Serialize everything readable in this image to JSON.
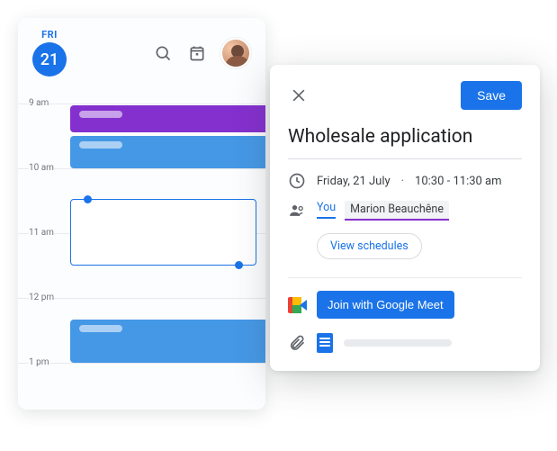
{
  "calendar": {
    "day_abbr": "FRI",
    "day_number": "21",
    "hours": [
      "9 am",
      "10 am",
      "11 am",
      "12 pm",
      "1 pm"
    ]
  },
  "panel": {
    "save_label": "Save",
    "title": "Wholesale application",
    "date_text": "Friday, 21 July",
    "time_text": "10:30 - 11:30 am",
    "guests": {
      "you_label": "You",
      "other_name": "Marion Beauchêne"
    },
    "view_schedules_label": "View schedules",
    "meet_button_label": "Join with Google Meet"
  }
}
